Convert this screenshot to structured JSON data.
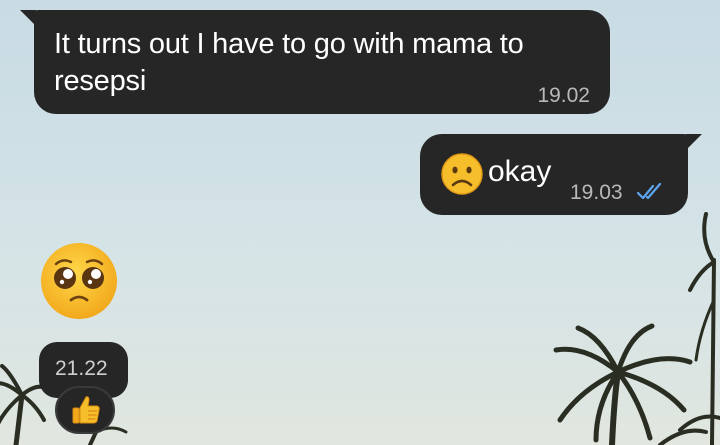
{
  "chat": {
    "messages": [
      {
        "direction": "incoming",
        "text": "It turns out I have to go with mama to resepsi",
        "time": "19.02"
      },
      {
        "direction": "outgoing",
        "emoji": "frowning-face",
        "text": "okay",
        "time": "19.03",
        "status": "read-double-check"
      },
      {
        "direction": "incoming",
        "emoji": "pleading-face",
        "time": "21.22",
        "reaction": "thumbs-up"
      }
    ]
  },
  "colors": {
    "bubble": "#262626",
    "text": "#ffffff",
    "timestamp": "#b9b9b9",
    "read_ticks": "#5ba6f0",
    "sky": "#cfe0e6",
    "emoji_yellow": "#f7be2b"
  }
}
